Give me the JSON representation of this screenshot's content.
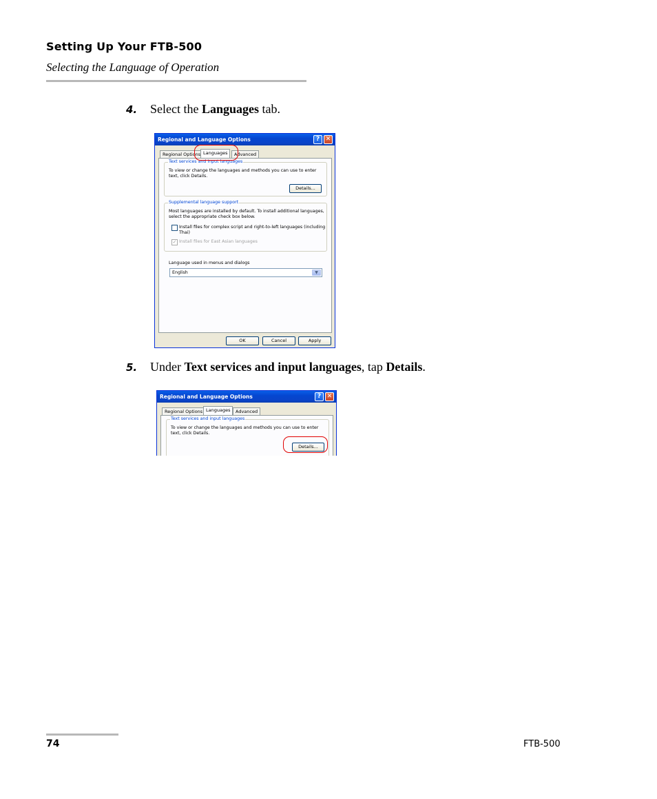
{
  "header": {
    "title": "Setting Up Your FTB-500",
    "subtitle": "Selecting the Language of Operation"
  },
  "steps": [
    {
      "number": "4.",
      "pre": "Select the ",
      "bold": "Languages",
      "post": " tab."
    },
    {
      "number": "5.",
      "pre": "Under ",
      "bold": "Text services and input languages",
      "mid": ", tap ",
      "bold2": "Details",
      "post": "."
    }
  ],
  "dialog": {
    "title": "Regional and Language Options",
    "help_glyph": "?",
    "close_glyph": "✕",
    "tabs": [
      "Regional Options",
      "Languages",
      "Advanced"
    ],
    "text_services": {
      "legend": "Text services and input languages",
      "line1": "To view or change the languages and methods you can use to enter",
      "line2": "text, click Details.",
      "details_button": "Details..."
    },
    "supplemental": {
      "legend": "Supplemental language support",
      "line1": "Most languages are installed by default. To install additional languages,",
      "line2": "select the appropriate check box below.",
      "complex_script_line1": "Install files for complex script and right-to-left languages (including",
      "complex_script_line2": "Thai)",
      "east_asian": "Install files for East Asian languages"
    },
    "menus_language": {
      "label": "Language used in menus and dialogs",
      "selected": "English"
    },
    "buttons": {
      "ok": "OK",
      "cancel": "Cancel",
      "apply": "Apply"
    }
  },
  "footer": {
    "page_number": "74",
    "product": "FTB-500"
  }
}
